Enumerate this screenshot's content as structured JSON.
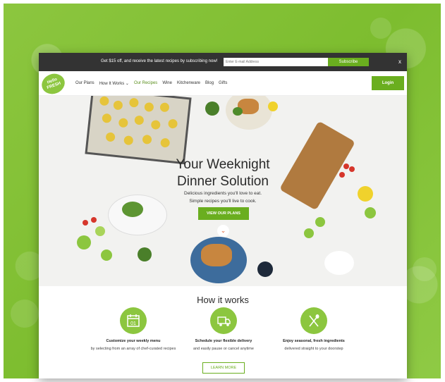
{
  "promo": {
    "text": "Get $15 off, and receive the latest recipes by subscribing now!",
    "email_placeholder": "Enter E-mail Address",
    "subscribe_label": "Subscribe",
    "close_label": "x"
  },
  "nav": {
    "logo_line1": "Hello",
    "logo_line2": "FRESH",
    "links": [
      {
        "label": "Our Plans"
      },
      {
        "label": "How It Works ⌄"
      },
      {
        "label": "Our Recipes"
      },
      {
        "label": "Wine"
      },
      {
        "label": "Kitchenware"
      },
      {
        "label": "Blog"
      },
      {
        "label": "Gifts"
      }
    ],
    "login_label": "Login"
  },
  "hero": {
    "title_line1": "Your Weeknight",
    "title_line2": "Dinner Solution",
    "sub_line1": "Delicious ingredients you'll love to eat.",
    "sub_line2": "Simple recipes you'll live to cook.",
    "cta_label": "VIEW OUR PLANS",
    "down_arrow": "⌄"
  },
  "how": {
    "title": "How it works",
    "steps": [
      {
        "title": "Customize your weekly menu",
        "desc": "by selecting from an array of chef-curated recipes",
        "icon": "calendar-icon",
        "icon_text": "01"
      },
      {
        "title": "Schedule your flexible delivery",
        "desc": "and easily pause or cancel anytime",
        "icon": "delivery-truck-icon"
      },
      {
        "title": "Enjoy seasonal, fresh ingredients",
        "desc": "delivered straight to your doorstep",
        "icon": "fork-spoon-icon"
      }
    ],
    "learn_more_label": "LEARN MORE"
  },
  "colors": {
    "brand_green": "#8cc63f",
    "button_green": "#6aae1f",
    "promo_bar": "#333333"
  }
}
